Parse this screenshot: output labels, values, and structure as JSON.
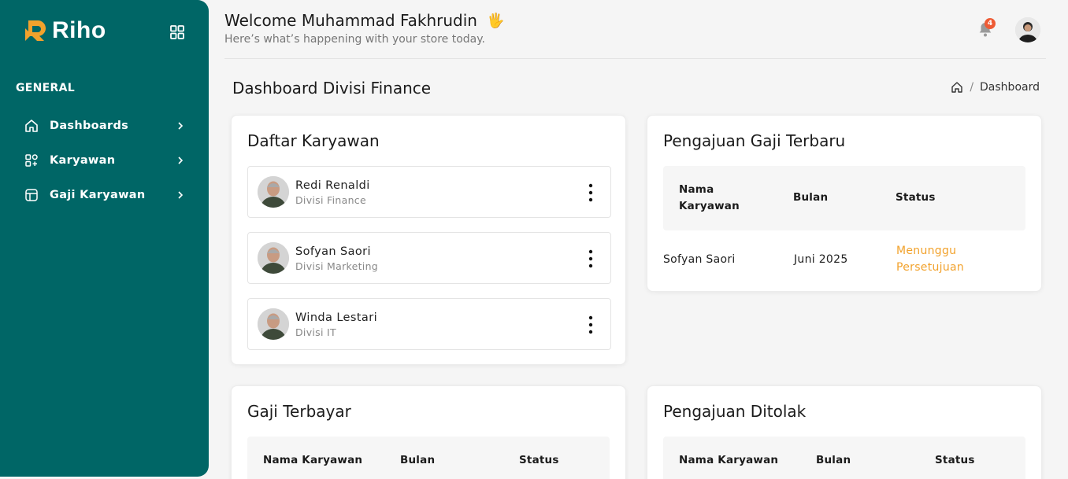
{
  "app": {
    "brand": "Riho"
  },
  "sidebar": {
    "section_label": "GENERAL",
    "items": [
      {
        "label": "Dashboards",
        "icon": "home-icon"
      },
      {
        "label": "Karyawan",
        "icon": "widgets-icon"
      },
      {
        "label": "Gaji Karyawan",
        "icon": "table-icon"
      }
    ]
  },
  "header": {
    "welcome": "Welcome Muhammad Fakhrudin",
    "wave": "🖐",
    "subtitle": "Here’s what’s happening with your store today.",
    "notification_count": "4"
  },
  "page": {
    "title": "Dashboard Divisi Finance",
    "breadcrumb": {
      "sep": "/",
      "current": "Dashboard"
    }
  },
  "daftar_karyawan": {
    "title": "Daftar Karyawan",
    "items": [
      {
        "name": "Redi Renaldi",
        "division": "Divisi Finance"
      },
      {
        "name": "Sofyan Saori",
        "division": "Divisi Marketing"
      },
      {
        "name": "Winda Lestari",
        "division": "Divisi IT"
      }
    ]
  },
  "pengajuan_terbaru": {
    "title": "Pengajuan Gaji Terbaru",
    "columns": [
      "Nama Karyawan",
      "Bulan",
      "Status"
    ],
    "rows": [
      {
        "nama": "Sofyan Saori",
        "bulan": "Juni 2025",
        "status": "Menunggu Persetujuan"
      }
    ]
  },
  "gaji_terbayar": {
    "title": "Gaji Terbayar",
    "columns": [
      "Nama Karyawan",
      "Bulan",
      "Status"
    ]
  },
  "pengajuan_ditolak": {
    "title": "Pengajuan Ditolak",
    "columns": [
      "Nama Karyawan",
      "Bulan",
      "Status"
    ]
  },
  "colors": {
    "sidebar": "#006666",
    "accent_orange": "#f2a22c",
    "badge": "#ee5b35"
  }
}
